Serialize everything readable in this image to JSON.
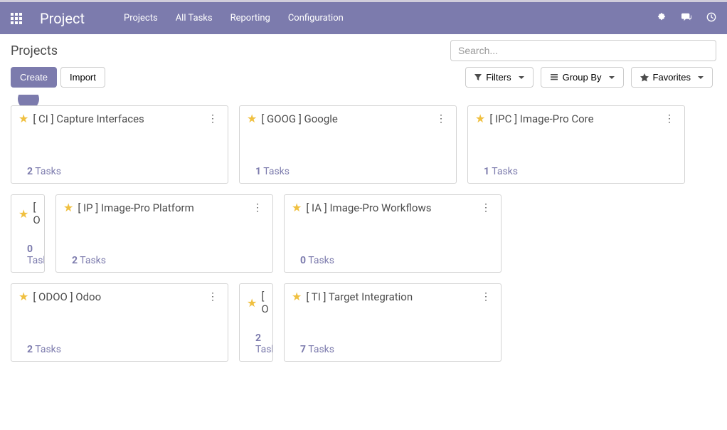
{
  "navbar": {
    "brand": "Project",
    "menu": [
      {
        "label": "Projects"
      },
      {
        "label": "All Tasks"
      },
      {
        "label": "Reporting"
      },
      {
        "label": "Configuration"
      }
    ]
  },
  "breadcrumb": "Projects",
  "search": {
    "placeholder": "Search..."
  },
  "actions": {
    "create": "Create",
    "import": "Import"
  },
  "toolbar": {
    "filters": "Filters",
    "group_by": "Group By",
    "favorites": "Favorites"
  },
  "tasks_label": "Tasks",
  "projects": [
    {
      "title": "[ CI ] Capture Interfaces",
      "count": "2"
    },
    {
      "title": "[ GOOG ] Google",
      "count": "1"
    },
    {
      "title": "[ IPC ] Image-Pro Core",
      "count": "1"
    },
    {
      "title": "[ O",
      "count": "0",
      "cut": true
    },
    {
      "title": "[ IP ] Image-Pro Platform",
      "count": "2"
    },
    {
      "title": "[ IA ] Image-Pro Workflows",
      "count": "0"
    },
    {
      "title": "[ ODOO ] Odoo",
      "count": "2"
    },
    {
      "title": "[ O",
      "count": "2",
      "cut": true
    },
    {
      "title": "[ TI ] Target Integration",
      "count": "7"
    }
  ]
}
